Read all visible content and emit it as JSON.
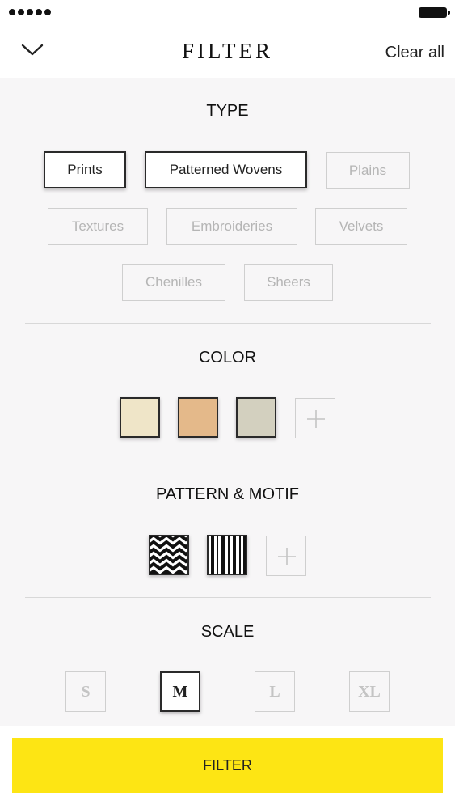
{
  "status_bar": {
    "signal_icon": "signal-dots-icon",
    "battery_icon": "battery-icon"
  },
  "header": {
    "back_icon": "chevron-down-icon",
    "title": "FILTER",
    "clear_all_label": "Clear all"
  },
  "type_section": {
    "title": "TYPE",
    "chips": [
      {
        "label": "Prints",
        "selected": true
      },
      {
        "label": "Patterned Wovens",
        "selected": true
      },
      {
        "label": "Plains",
        "selected": false
      },
      {
        "label": "Textures",
        "selected": false
      },
      {
        "label": "Embroideries",
        "selected": false
      },
      {
        "label": "Velvets",
        "selected": false
      },
      {
        "label": "Chenilles",
        "selected": false
      },
      {
        "label": "Sheers",
        "selected": false
      }
    ]
  },
  "color_section": {
    "title": "COLOR",
    "swatches": [
      "#efe5c8",
      "#e4b98a",
      "#d3d0bf"
    ],
    "add_icon": "plus-icon"
  },
  "pattern_section": {
    "title": "PATTERN & MOTIF",
    "patterns": [
      "chevron-pattern-icon",
      "stripes-pattern-icon"
    ],
    "add_icon": "plus-icon"
  },
  "scale_section": {
    "title": "SCALE",
    "options": [
      {
        "label": "S",
        "selected": false
      },
      {
        "label": "M",
        "selected": true
      },
      {
        "label": "L",
        "selected": false
      },
      {
        "label": "XL",
        "selected": false
      }
    ]
  },
  "footer": {
    "filter_button_label": "FILTER"
  },
  "colors": {
    "accent": "#fde514",
    "selected_border": "#2a2a2a",
    "muted_text": "#b5b5b5"
  }
}
